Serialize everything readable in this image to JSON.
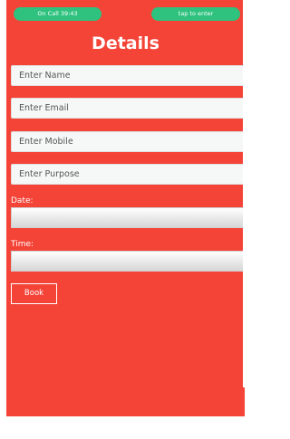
{
  "status": {
    "call_pill": "On Call  39:43",
    "tap_pill": "tap to enter"
  },
  "page": {
    "title": "Details"
  },
  "form": {
    "name_placeholder": "Enter Name",
    "email_placeholder": "Enter Email",
    "mobile_placeholder": "Enter Mobile",
    "purpose_placeholder": "Enter Purpose",
    "date_label": "Date:",
    "time_label": "Time:",
    "book_label": "Book"
  },
  "colors": {
    "background": "#f44337",
    "pill": "#2ec27e"
  }
}
